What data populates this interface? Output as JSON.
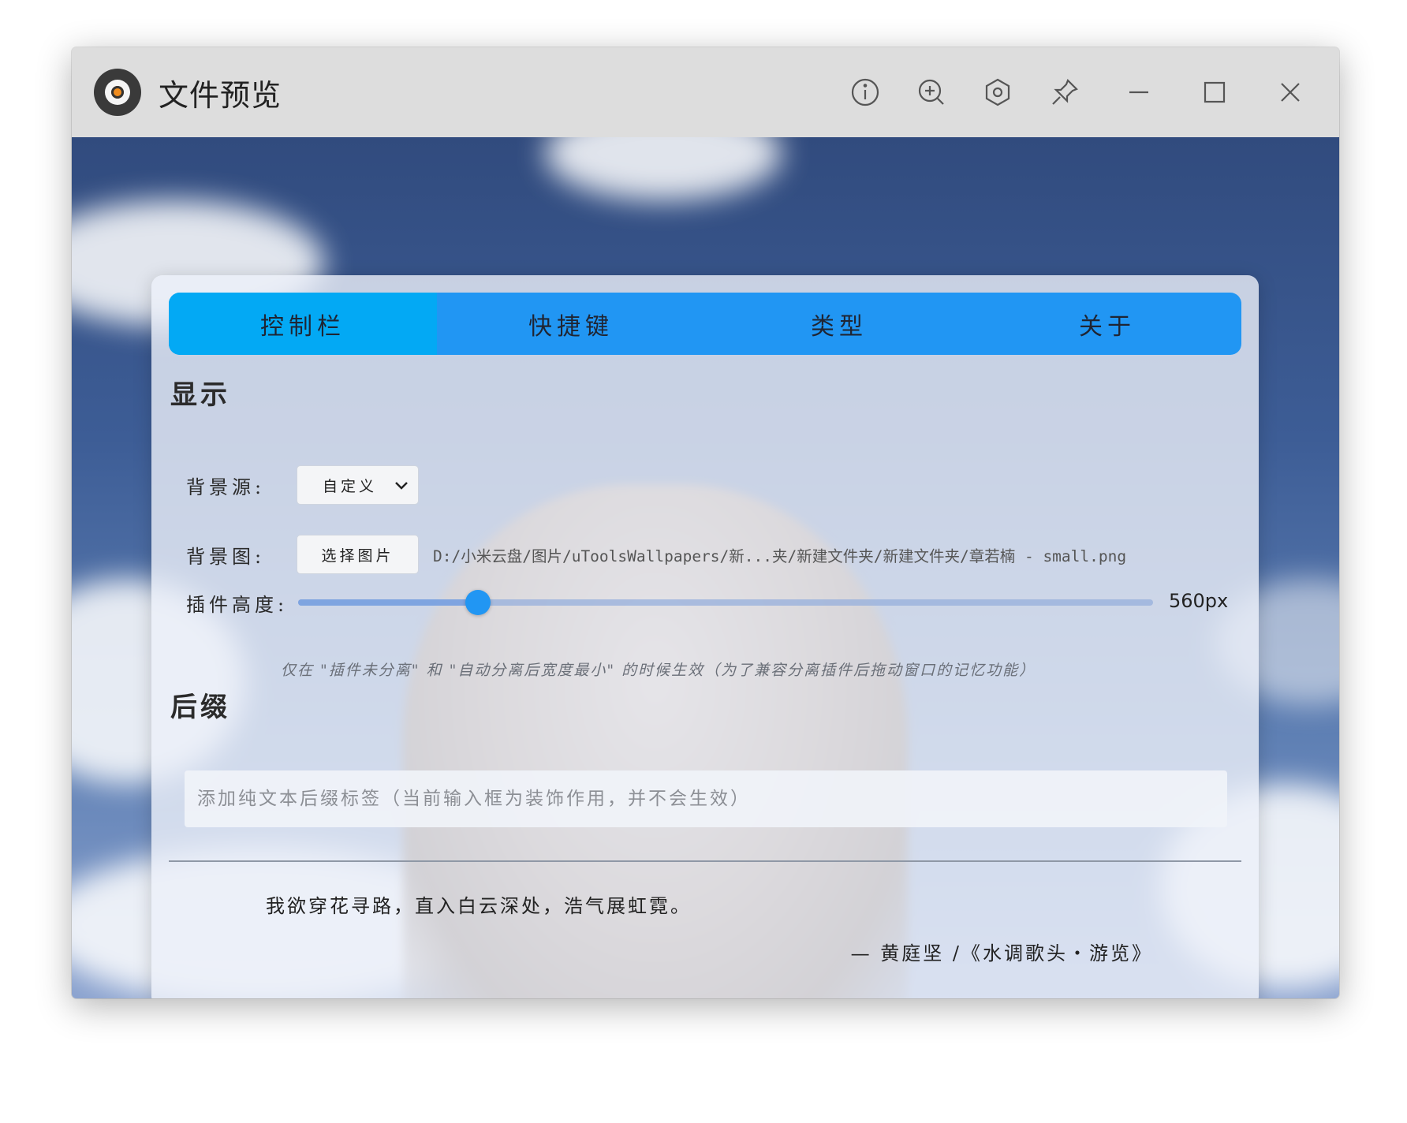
{
  "window": {
    "title": "文件预览",
    "toolbar_icons": [
      "info-icon",
      "zoom-in-icon",
      "settings-icon",
      "pin-icon",
      "minimize-icon",
      "maximize-icon",
      "close-icon"
    ]
  },
  "tabs": [
    {
      "label": "控制栏",
      "active": true
    },
    {
      "label": "快捷键",
      "active": false
    },
    {
      "label": "类型",
      "active": false
    },
    {
      "label": "关于",
      "active": false
    }
  ],
  "display": {
    "title": "显示",
    "background_source": {
      "label": "背景源:",
      "selected": "自定义"
    },
    "background_image": {
      "label": "背景图:",
      "button": "选择图片",
      "path": "D:/小米云盘/图片/uToolsWallpapers/新...夹/新建文件夹/新建文件夹/章若楠 - small.png"
    },
    "plugin_height": {
      "label": "插件高度:",
      "value_text": "560px",
      "fraction": 0.21
    },
    "note": "仅在 \"插件未分离\" 和 \"自动分离后宽度最小\" 的时候生效（为了兼容分离插件后拖动窗口的记忆功能）"
  },
  "suffix": {
    "title": "后缀",
    "placeholder": "添加纯文本后缀标签（当前输入框为装饰作用，并不会生效）"
  },
  "quote": {
    "text": "我欲穿花寻路，直入白云深处，浩气展虹霓。",
    "author": "— 黄庭坚 /《水调歌头・游览》"
  },
  "colors": {
    "tab_bar": "#2196f3",
    "tab_active": "#03a9f4",
    "slider_thumb": "#2196f3"
  }
}
